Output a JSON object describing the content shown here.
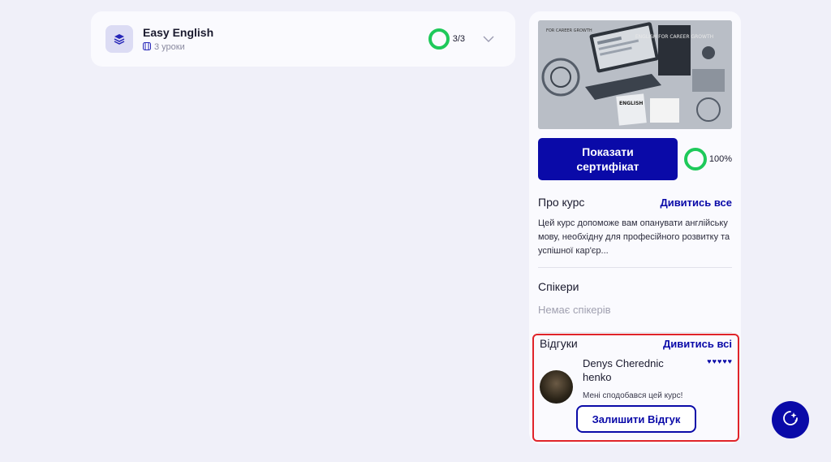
{
  "module": {
    "title": "Easy English",
    "lessons": "3 уроки",
    "progress": "3/3",
    "progress_fraction": 1.0
  },
  "course": {
    "image_alt_texts": [
      "FOR CAREER GROWTH",
      "ENGLISH FOR CAREER GROWTH",
      "ENGLISH"
    ],
    "certificate_button": "Показати\nсертифікат",
    "completion": "100%",
    "completion_fraction": 1.0,
    "about": {
      "title": "Про курс",
      "link": "Дивитись все",
      "text": "Цей курс допоможе вам опанувати англійську мову, необхідну для професійного розвитку та успішної кар'єр..."
    },
    "speakers": {
      "title": "Спікери",
      "empty": "Немає спікерів"
    },
    "reviews": {
      "title": "Відгуки",
      "link": "Дивитись всі",
      "items": [
        {
          "author": "Denys Cherednichenko",
          "rating": 5,
          "text": "Мені сподобався цей курс!"
        }
      ],
      "leave_button": "Залишити Відгук"
    }
  },
  "colors": {
    "accent": "#0a0aa8",
    "progress": "#1ec95a",
    "highlight": "#e0242a",
    "background": "#f0f0f9"
  },
  "icons": {
    "module": "stack-layers-icon",
    "lessons": "video-icon",
    "expand": "chevron-down-icon",
    "fab": "ai-assistant-icon"
  }
}
